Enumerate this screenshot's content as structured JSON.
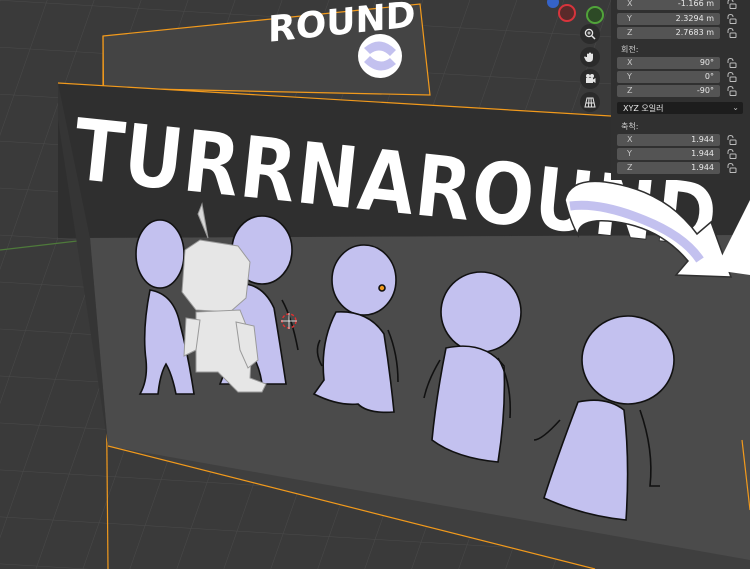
{
  "scene": {
    "banner_text": "TURRNAROUND",
    "back_banner_text": "ROUND"
  },
  "navigation": {
    "zoom_icon": "zoom-icon",
    "pan_icon": "hand-icon",
    "camera_icon": "camera-icon",
    "grid_icon": "grid-icon"
  },
  "sidebar": {
    "location": {
      "x": "-1.166 m",
      "y": "2.3294 m",
      "z": "2.7683 m"
    },
    "rotation": {
      "label": "회전:",
      "x": "90°",
      "y": "0°",
      "z": "-90°",
      "mode": "XYZ 오일러"
    },
    "scale": {
      "label": "축척:",
      "x": "1.944",
      "y": "1.944",
      "z": "1.944"
    },
    "axis_labels": {
      "x": "X",
      "y": "Y",
      "z": "Z"
    }
  },
  "colors": {
    "background": "#3a3a3a",
    "board": "#434343",
    "character": "#c3c1ef",
    "selection": "#f29a1c",
    "gizmo_red": "#d8343c",
    "gizmo_green": "#51a43a",
    "gizmo_blue": "#3563c8"
  }
}
